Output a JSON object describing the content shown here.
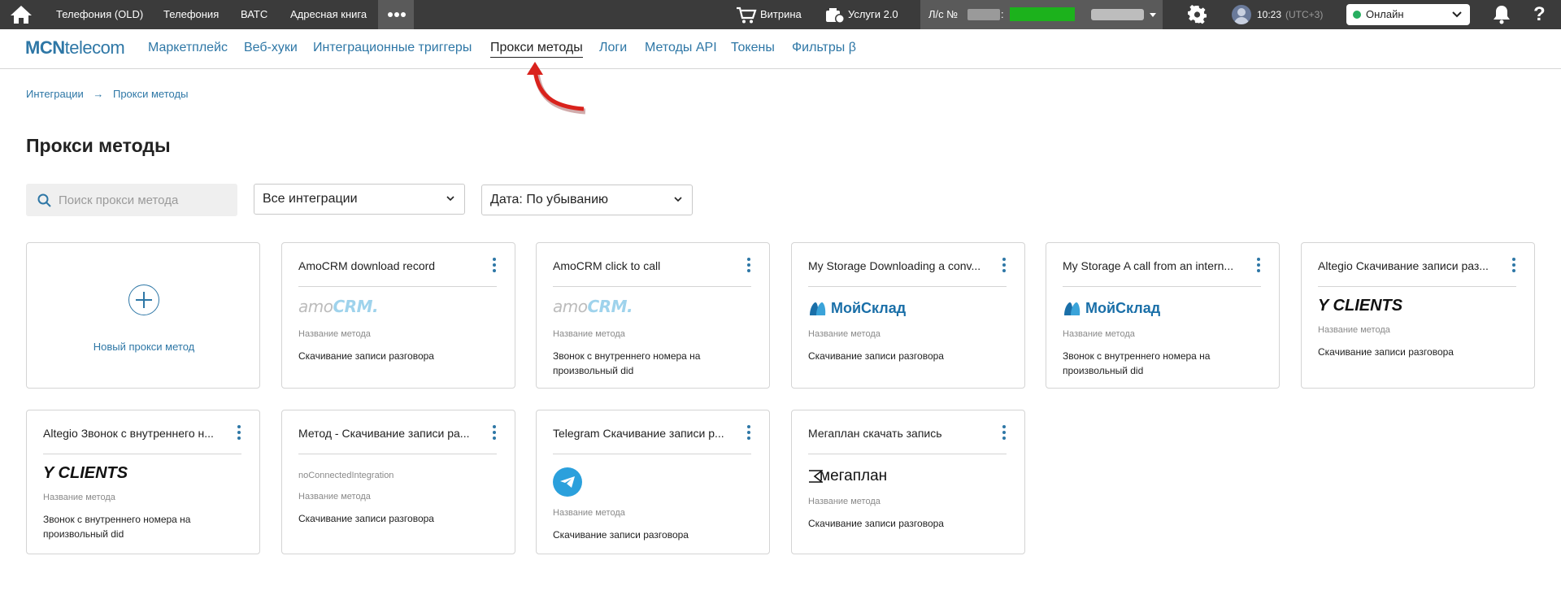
{
  "topbar": {
    "tabs": [
      "Телефония (OLD)",
      "Телефония",
      "ВАТС",
      "Адресная книга"
    ],
    "vitrina_label": "Витрина",
    "services_label": "Услуги 2.0",
    "account_prefix": "Л/с №",
    "account_colon": ":",
    "time": "10:23",
    "timezone": "(UTC+3)",
    "status": "Онлайн",
    "help": "?"
  },
  "nav": {
    "logo_bold": "MCN",
    "logo_rest": "telecom",
    "links": [
      "Маркетплейс",
      "Веб-хуки",
      "Интеграционные триггеры",
      "Прокси методы",
      "Логи",
      "Методы API",
      "Токены",
      "Фильтры β"
    ]
  },
  "breadcrumb": {
    "parent": "Интеграции",
    "current": "Прокси методы"
  },
  "page_title": "Прокси методы",
  "filters": {
    "search_placeholder": "Поиск прокси метода",
    "integration_select": "Все интеграции",
    "sort_select": "Дата: По убыванию"
  },
  "new_card_label": "Новый прокси метод",
  "cards": [
    {
      "title": "AmoCRM download record",
      "logo": "amocrm",
      "logo_a": "amo",
      "logo_b": "CRM.",
      "label": "Название метода",
      "value": "Скачивание записи разговора"
    },
    {
      "title": "AmoCRM click to call",
      "logo": "amocrm",
      "logo_a": "amo",
      "logo_b": "CRM.",
      "label": "Название метода",
      "value": "Звонок с внутреннего номера на произвольный did"
    },
    {
      "title": "My Storage Downloading a conv...",
      "logo": "moysklad",
      "logo_text": "МойСклад",
      "label": "Название метода",
      "value": "Скачивание записи разговора"
    },
    {
      "title": "My Storage A call from an intern...",
      "logo": "moysklad",
      "logo_text": "МойСклад",
      "label": "Название метода",
      "value": "Звонок с внутреннего номера на произвольный did"
    },
    {
      "title": "Altegio Скачивание записи раз...",
      "logo": "yclients",
      "logo_text": "Y CLIENTS",
      "label": "Название метода",
      "value": "Скачивание записи разговора"
    },
    {
      "title": "Altegio Звонок с внутреннего н...",
      "logo": "yclients",
      "logo_text": "Y CLIENTS",
      "label": "Название метода",
      "value": "Звонок с внутреннего номера на произвольный did"
    },
    {
      "title": "Метод - Скачивание записи ра...",
      "logo": "text",
      "logo_text": "noConnectedIntegration",
      "label": "Название метода",
      "value": "Скачивание записи разговора"
    },
    {
      "title": "Telegram Скачивание записи р...",
      "logo": "telegram",
      "label": "Название метода",
      "value": "Скачивание записи разговора"
    },
    {
      "title": "Мегаплан скачать запись",
      "logo": "megaplan",
      "logo_text": "мегаплан",
      "label": "Название метода",
      "value": "Скачивание записи разговора"
    }
  ],
  "colors": {
    "topbar": "#3b3b3b",
    "accent": "#2e77a6",
    "online": "#27ae60",
    "annotation_arrow": "#d9221c"
  }
}
